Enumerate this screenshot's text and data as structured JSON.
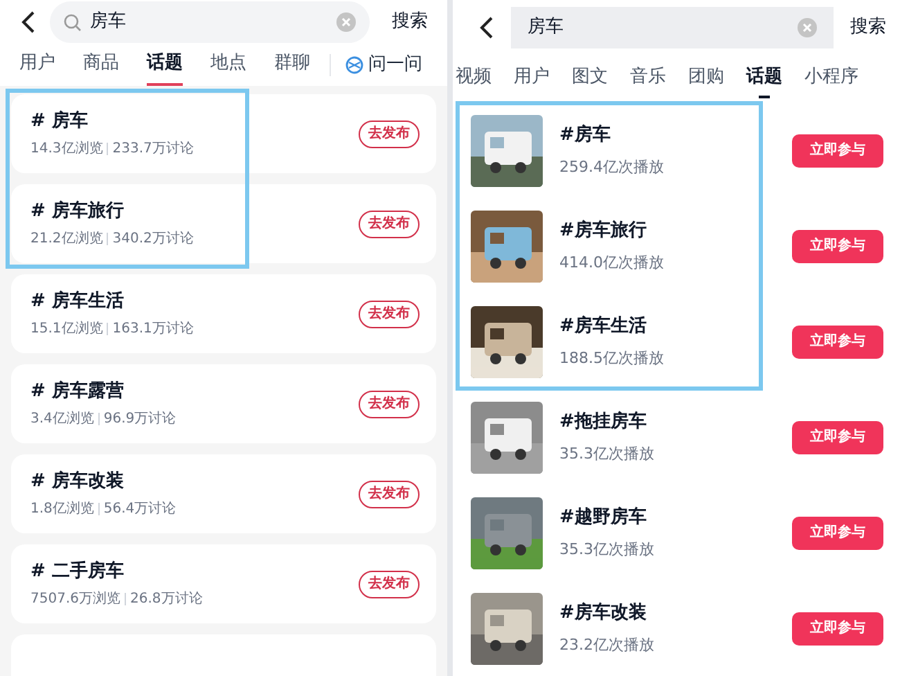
{
  "left": {
    "search": {
      "value": "房车",
      "action": "搜索"
    },
    "tabs": [
      {
        "label": "用户",
        "selected": false
      },
      {
        "label": "商品",
        "selected": false
      },
      {
        "label": "话题",
        "selected": true
      },
      {
        "label": "地点",
        "selected": false
      },
      {
        "label": "群聊",
        "selected": false
      }
    ],
    "ask": "问一问",
    "topics": [
      {
        "title": "# 房车",
        "views": "14.3亿浏览",
        "discussions": "233.7万讨论",
        "button": "去发布",
        "highlighted": true
      },
      {
        "title": "# 房车旅行",
        "views": "21.2亿浏览",
        "discussions": "340.2万讨论",
        "button": "去发布",
        "highlighted": true
      },
      {
        "title": "# 房车生活",
        "views": "15.1亿浏览",
        "discussions": "163.1万讨论",
        "button": "去发布",
        "highlighted": false
      },
      {
        "title": "# 房车露营",
        "views": "3.4亿浏览",
        "discussions": "96.9万讨论",
        "button": "去发布",
        "highlighted": false
      },
      {
        "title": "# 房车改装",
        "views": "1.8亿浏览",
        "discussions": "56.4万讨论",
        "button": "去发布",
        "highlighted": false
      },
      {
        "title": "# 二手房车",
        "views": "7507.6万浏览",
        "discussions": "26.8万讨论",
        "button": "去发布",
        "highlighted": false
      }
    ]
  },
  "right": {
    "search": {
      "value": "房车",
      "action": "搜索"
    },
    "tabs": [
      {
        "label": "视频",
        "selected": false
      },
      {
        "label": "用户",
        "selected": false
      },
      {
        "label": "图文",
        "selected": false
      },
      {
        "label": "音乐",
        "selected": false
      },
      {
        "label": "团购",
        "selected": false
      },
      {
        "label": "话题",
        "selected": true
      },
      {
        "label": "小程序",
        "selected": false
      }
    ],
    "topics": [
      {
        "title": "#房车",
        "plays": "259.4亿次播放",
        "button": "立即参与",
        "highlighted": true
      },
      {
        "title": "#房车旅行",
        "plays": "414.0亿次播放",
        "button": "立即参与",
        "highlighted": true
      },
      {
        "title": "#房车生活",
        "plays": "188.5亿次播放",
        "button": "立即参与",
        "highlighted": true
      },
      {
        "title": "#拖挂房车",
        "plays": "35.3亿次播放",
        "button": "立即参与",
        "highlighted": false
      },
      {
        "title": "#越野房车",
        "plays": "35.3亿次播放",
        "button": "立即参与",
        "highlighted": false
      },
      {
        "title": "#房车改装",
        "plays": "23.2亿次播放",
        "button": "立即参与",
        "highlighted": false
      }
    ]
  }
}
